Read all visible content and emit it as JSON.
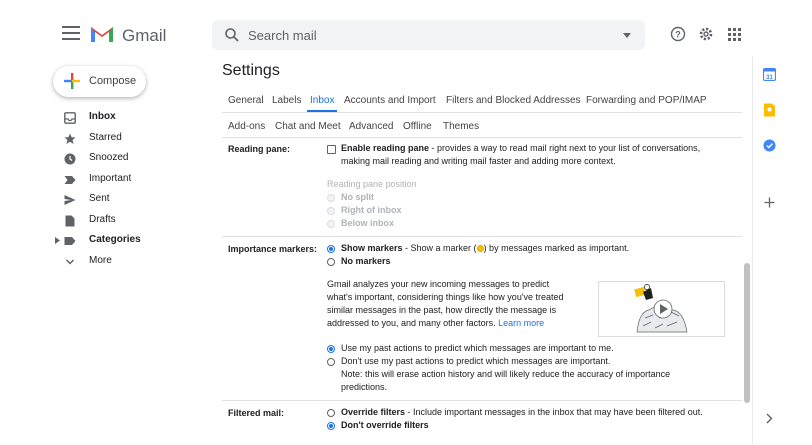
{
  "header": {
    "app_name": "Gmail",
    "search_placeholder": "Search mail",
    "help_icon": "help-icon",
    "settings_icon": "gear-icon",
    "apps_icon": "apps-grid-icon"
  },
  "sidebar": {
    "compose_label": "Compose",
    "items": [
      {
        "label": "Inbox",
        "icon": "inbox-icon",
        "bold": true
      },
      {
        "label": "Starred",
        "icon": "star-icon"
      },
      {
        "label": "Snoozed",
        "icon": "clock-icon"
      },
      {
        "label": "Important",
        "icon": "important-icon"
      },
      {
        "label": "Sent",
        "icon": "send-icon"
      },
      {
        "label": "Drafts",
        "icon": "draft-icon"
      },
      {
        "label": "Categories",
        "icon": "label-icon",
        "bold": true
      },
      {
        "label": "More",
        "icon": "chevron-down-icon"
      }
    ]
  },
  "settings": {
    "title": "Settings",
    "tabs_row1": [
      "General",
      "Labels",
      "Inbox",
      "Accounts and Import",
      "Filters and Blocked Addresses",
      "Forwarding and POP/IMAP"
    ],
    "tabs_row2": [
      "Add-ons",
      "Chat and Meet",
      "Advanced",
      "Offline",
      "Themes"
    ],
    "active_tab": "Inbox",
    "reading_pane": {
      "label": "Reading pane:",
      "enable_bold": "Enable reading pane",
      "enable_desc": " - provides a way to read mail right next to your list of conversations,",
      "enable_desc2": "making mail reading and writing mail faster and adding more context.",
      "position_label": "Reading pane position",
      "options": [
        "No split",
        "Right of inbox",
        "Below inbox"
      ]
    },
    "importance_markers": {
      "label": "Importance markers:",
      "show_bold": "Show markers",
      "show_desc_a": " - Show a marker (",
      "show_desc_b": ") by messages marked as important.",
      "no_markers": "No markers",
      "info_line1": "Gmail analyzes your new incoming messages to predict",
      "info_line2": "what's important, considering things like how you've treated",
      "info_line3": "similar messages in the past, how directly the message is",
      "info_line4": "addressed to you, and many other factors.",
      "learn_more": "Learn more",
      "use_past": "Use my past actions to predict which messages are important to me.",
      "dont_use": "Don't use my past actions to predict which messages are important.",
      "note_line1": "Note: this will erase action history and will likely reduce the accuracy of importance",
      "note_line2": "predictions."
    },
    "filtered_mail": {
      "label": "Filtered mail:",
      "override_bold": "Override filters",
      "override_desc": " - Include important messages in the inbox that may have been filtered out.",
      "dont_override": "Don't override filters"
    }
  },
  "side_panel": {
    "icons": [
      "calendar-icon",
      "keep-icon",
      "tasks-icon",
      "add-icon",
      "chevron-right-icon"
    ]
  },
  "colors": {
    "accent": "#1a73e8",
    "gmail_red": "#ea4335",
    "marker_yellow": "#f4c20d"
  }
}
